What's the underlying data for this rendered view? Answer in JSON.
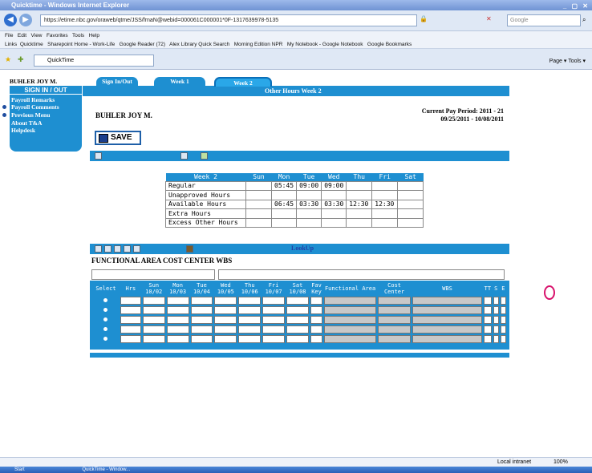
{
  "browser": {
    "title": "Quicktime - Windows Internet Explorer",
    "url": "https://etime.nbc.gov/oraweb/qtme/JSS/frnaN@webid=000061C000001*0F-1317639978-5135",
    "search_placeholder": "Google",
    "menu": [
      "File",
      "Edit",
      "View",
      "Favorites",
      "Tools",
      "Help"
    ],
    "favorites_label": "Links",
    "favorites": [
      "Quicktime",
      "Sharepoint Home - Work-Life",
      "Google Reader (72)",
      "Alex Library Quick Search",
      "Morning Edition NPR",
      "My Notebook - Google Notebook",
      "Google Bookmarks"
    ],
    "tab_label": "QuickTime",
    "tools_text": "Page ▾  Tools ▾",
    "status_zone": "Local intranet",
    "zoom": "100%",
    "taskbar_start": "Start",
    "taskbar_item": "QuickTime - Window..."
  },
  "sidebar": {
    "employee": "BUHLER JOY M.",
    "sign_label": "SIGN IN / OUT",
    "items": [
      "Payroll Remarks",
      "Payroll Comments",
      "Previous Menu",
      "About T&A Helpdesk"
    ]
  },
  "tabs": [
    "Sign In/Out",
    "Week 1",
    "Week 2"
  ],
  "header": {
    "section_title": "Other Hours Week 2",
    "employee_name": "BUHLER JOY M.",
    "pay_period_label": "Current Pay Period:  2011 - 21",
    "pay_period_dates": "09/25/2011 - 10/08/2011",
    "save_label": "SAVE"
  },
  "week_table": {
    "title": "Week 2",
    "days": [
      "Sun",
      "Mon",
      "Tue",
      "Wed",
      "Thu",
      "Fri",
      "Sat"
    ],
    "rows": [
      {
        "label": "Regular",
        "values": [
          "",
          "05:45",
          "09:00",
          "09:00",
          "",
          "",
          ""
        ]
      },
      {
        "label": "Unapproved Hours",
        "values": [
          "",
          "",
          "",
          "",
          "",
          "",
          ""
        ]
      },
      {
        "label": "Available Hours",
        "values": [
          "",
          "06:45",
          "03:30",
          "03:30",
          "12:30",
          "12:30",
          ""
        ]
      },
      {
        "label": "Extra Hours",
        "values": [
          "",
          "",
          "",
          "",
          "",
          "",
          ""
        ]
      },
      {
        "label": "Excess Other Hours",
        "values": [
          "",
          "",
          "",
          "",
          "",
          "",
          ""
        ]
      }
    ]
  },
  "lookup_label": "LookUp",
  "fcw_label": "FUNCTIONAL AREA  COST CENTER  WBS",
  "entry_grid": {
    "headers": [
      "Select",
      "Hrs",
      "Sun 10/02",
      "Mon 10/03",
      "Tue 10/04",
      "Wed 10/05",
      "Thu 10/06",
      "Fri 10/07",
      "Sat 10/08",
      "Fav Key",
      "Functional Area",
      "Cost Center",
      "WBS",
      "TT",
      "S",
      "E"
    ],
    "row_count": 5
  },
  "colors": {
    "accent": "#1e8fd1",
    "highlight": "#d8116b"
  }
}
